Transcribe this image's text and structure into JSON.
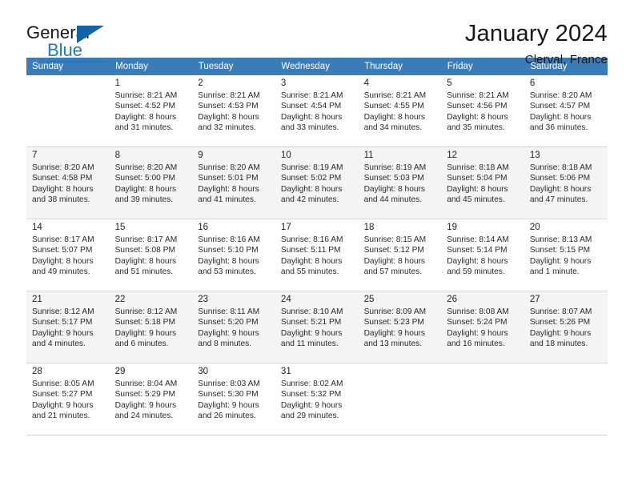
{
  "brand": {
    "word_one": "General",
    "word_two": "Blue",
    "accent_color": "#1f7ac0",
    "triangle_color": "#1464a5"
  },
  "header": {
    "title": "January 2024",
    "subtitle": "Clerval, France"
  },
  "calendar": {
    "header_bg": "#3a7cba",
    "alt_row_bg": "#f4f4f4",
    "weekday_headers": [
      "Sunday",
      "Monday",
      "Tuesday",
      "Wednesday",
      "Thursday",
      "Friday",
      "Saturday"
    ],
    "weeks": [
      [
        {
          "day": "",
          "sunrise": "",
          "sunset": "",
          "daylight_1": "",
          "daylight_2": ""
        },
        {
          "day": "1",
          "sunrise": "Sunrise: 8:21 AM",
          "sunset": "Sunset: 4:52 PM",
          "daylight_1": "Daylight: 8 hours",
          "daylight_2": "and 31 minutes."
        },
        {
          "day": "2",
          "sunrise": "Sunrise: 8:21 AM",
          "sunset": "Sunset: 4:53 PM",
          "daylight_1": "Daylight: 8 hours",
          "daylight_2": "and 32 minutes."
        },
        {
          "day": "3",
          "sunrise": "Sunrise: 8:21 AM",
          "sunset": "Sunset: 4:54 PM",
          "daylight_1": "Daylight: 8 hours",
          "daylight_2": "and 33 minutes."
        },
        {
          "day": "4",
          "sunrise": "Sunrise: 8:21 AM",
          "sunset": "Sunset: 4:55 PM",
          "daylight_1": "Daylight: 8 hours",
          "daylight_2": "and 34 minutes."
        },
        {
          "day": "5",
          "sunrise": "Sunrise: 8:21 AM",
          "sunset": "Sunset: 4:56 PM",
          "daylight_1": "Daylight: 8 hours",
          "daylight_2": "and 35 minutes."
        },
        {
          "day": "6",
          "sunrise": "Sunrise: 8:20 AM",
          "sunset": "Sunset: 4:57 PM",
          "daylight_1": "Daylight: 8 hours",
          "daylight_2": "and 36 minutes."
        }
      ],
      [
        {
          "day": "7",
          "sunrise": "Sunrise: 8:20 AM",
          "sunset": "Sunset: 4:58 PM",
          "daylight_1": "Daylight: 8 hours",
          "daylight_2": "and 38 minutes."
        },
        {
          "day": "8",
          "sunrise": "Sunrise: 8:20 AM",
          "sunset": "Sunset: 5:00 PM",
          "daylight_1": "Daylight: 8 hours",
          "daylight_2": "and 39 minutes."
        },
        {
          "day": "9",
          "sunrise": "Sunrise: 8:20 AM",
          "sunset": "Sunset: 5:01 PM",
          "daylight_1": "Daylight: 8 hours",
          "daylight_2": "and 41 minutes."
        },
        {
          "day": "10",
          "sunrise": "Sunrise: 8:19 AM",
          "sunset": "Sunset: 5:02 PM",
          "daylight_1": "Daylight: 8 hours",
          "daylight_2": "and 42 minutes."
        },
        {
          "day": "11",
          "sunrise": "Sunrise: 8:19 AM",
          "sunset": "Sunset: 5:03 PM",
          "daylight_1": "Daylight: 8 hours",
          "daylight_2": "and 44 minutes."
        },
        {
          "day": "12",
          "sunrise": "Sunrise: 8:18 AM",
          "sunset": "Sunset: 5:04 PM",
          "daylight_1": "Daylight: 8 hours",
          "daylight_2": "and 45 minutes."
        },
        {
          "day": "13",
          "sunrise": "Sunrise: 8:18 AM",
          "sunset": "Sunset: 5:06 PM",
          "daylight_1": "Daylight: 8 hours",
          "daylight_2": "and 47 minutes."
        }
      ],
      [
        {
          "day": "14",
          "sunrise": "Sunrise: 8:17 AM",
          "sunset": "Sunset: 5:07 PM",
          "daylight_1": "Daylight: 8 hours",
          "daylight_2": "and 49 minutes."
        },
        {
          "day": "15",
          "sunrise": "Sunrise: 8:17 AM",
          "sunset": "Sunset: 5:08 PM",
          "daylight_1": "Daylight: 8 hours",
          "daylight_2": "and 51 minutes."
        },
        {
          "day": "16",
          "sunrise": "Sunrise: 8:16 AM",
          "sunset": "Sunset: 5:10 PM",
          "daylight_1": "Daylight: 8 hours",
          "daylight_2": "and 53 minutes."
        },
        {
          "day": "17",
          "sunrise": "Sunrise: 8:16 AM",
          "sunset": "Sunset: 5:11 PM",
          "daylight_1": "Daylight: 8 hours",
          "daylight_2": "and 55 minutes."
        },
        {
          "day": "18",
          "sunrise": "Sunrise: 8:15 AM",
          "sunset": "Sunset: 5:12 PM",
          "daylight_1": "Daylight: 8 hours",
          "daylight_2": "and 57 minutes."
        },
        {
          "day": "19",
          "sunrise": "Sunrise: 8:14 AM",
          "sunset": "Sunset: 5:14 PM",
          "daylight_1": "Daylight: 8 hours",
          "daylight_2": "and 59 minutes."
        },
        {
          "day": "20",
          "sunrise": "Sunrise: 8:13 AM",
          "sunset": "Sunset: 5:15 PM",
          "daylight_1": "Daylight: 9 hours",
          "daylight_2": "and 1 minute."
        }
      ],
      [
        {
          "day": "21",
          "sunrise": "Sunrise: 8:12 AM",
          "sunset": "Sunset: 5:17 PM",
          "daylight_1": "Daylight: 9 hours",
          "daylight_2": "and 4 minutes."
        },
        {
          "day": "22",
          "sunrise": "Sunrise: 8:12 AM",
          "sunset": "Sunset: 5:18 PM",
          "daylight_1": "Daylight: 9 hours",
          "daylight_2": "and 6 minutes."
        },
        {
          "day": "23",
          "sunrise": "Sunrise: 8:11 AM",
          "sunset": "Sunset: 5:20 PM",
          "daylight_1": "Daylight: 9 hours",
          "daylight_2": "and 8 minutes."
        },
        {
          "day": "24",
          "sunrise": "Sunrise: 8:10 AM",
          "sunset": "Sunset: 5:21 PM",
          "daylight_1": "Daylight: 9 hours",
          "daylight_2": "and 11 minutes."
        },
        {
          "day": "25",
          "sunrise": "Sunrise: 8:09 AM",
          "sunset": "Sunset: 5:23 PM",
          "daylight_1": "Daylight: 9 hours",
          "daylight_2": "and 13 minutes."
        },
        {
          "day": "26",
          "sunrise": "Sunrise: 8:08 AM",
          "sunset": "Sunset: 5:24 PM",
          "daylight_1": "Daylight: 9 hours",
          "daylight_2": "and 16 minutes."
        },
        {
          "day": "27",
          "sunrise": "Sunrise: 8:07 AM",
          "sunset": "Sunset: 5:26 PM",
          "daylight_1": "Daylight: 9 hours",
          "daylight_2": "and 18 minutes."
        }
      ],
      [
        {
          "day": "28",
          "sunrise": "Sunrise: 8:05 AM",
          "sunset": "Sunset: 5:27 PM",
          "daylight_1": "Daylight: 9 hours",
          "daylight_2": "and 21 minutes."
        },
        {
          "day": "29",
          "sunrise": "Sunrise: 8:04 AM",
          "sunset": "Sunset: 5:29 PM",
          "daylight_1": "Daylight: 9 hours",
          "daylight_2": "and 24 minutes."
        },
        {
          "day": "30",
          "sunrise": "Sunrise: 8:03 AM",
          "sunset": "Sunset: 5:30 PM",
          "daylight_1": "Daylight: 9 hours",
          "daylight_2": "and 26 minutes."
        },
        {
          "day": "31",
          "sunrise": "Sunrise: 8:02 AM",
          "sunset": "Sunset: 5:32 PM",
          "daylight_1": "Daylight: 9 hours",
          "daylight_2": "and 29 minutes."
        },
        {
          "day": "",
          "sunrise": "",
          "sunset": "",
          "daylight_1": "",
          "daylight_2": ""
        },
        {
          "day": "",
          "sunrise": "",
          "sunset": "",
          "daylight_1": "",
          "daylight_2": ""
        },
        {
          "day": "",
          "sunrise": "",
          "sunset": "",
          "daylight_1": "",
          "daylight_2": ""
        }
      ]
    ]
  }
}
